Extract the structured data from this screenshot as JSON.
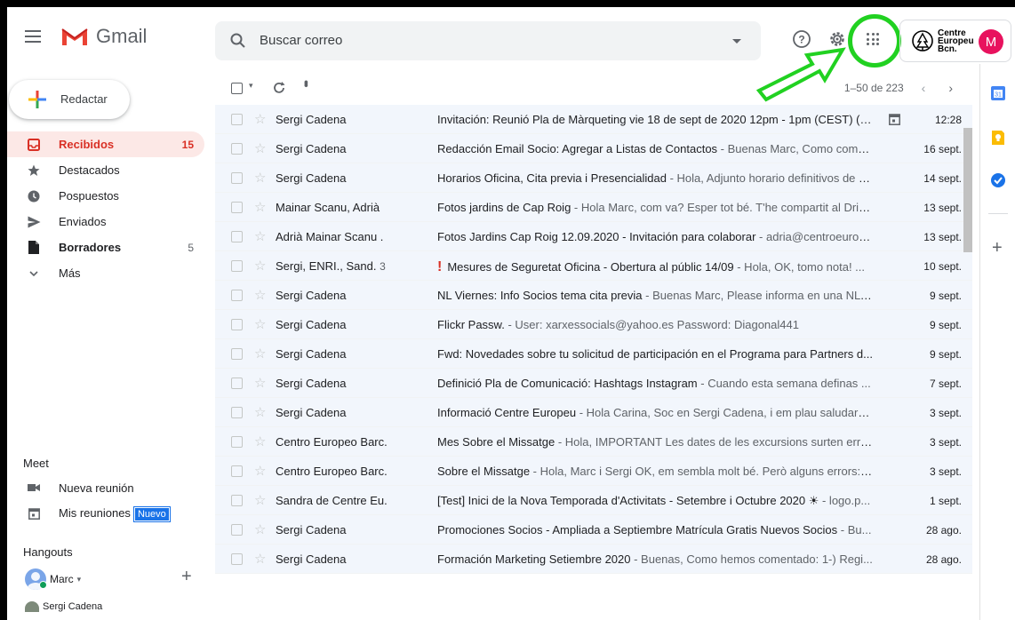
{
  "header": {
    "app_name": "Gmail",
    "search_placeholder": "Buscar correo",
    "brand_text_line1": "Centre",
    "brand_text_line2": "Europeu",
    "brand_text_line3": "Bcn.",
    "avatar_letter": "M"
  },
  "sidebar": {
    "compose_label": "Redactar",
    "items": [
      {
        "label": "Recibidos",
        "count": "15",
        "icon": "inbox-icon"
      },
      {
        "label": "Destacados",
        "count": "",
        "icon": "star-icon"
      },
      {
        "label": "Pospuestos",
        "count": "",
        "icon": "clock-icon"
      },
      {
        "label": "Enviados",
        "count": "",
        "icon": "send-icon"
      },
      {
        "label": "Borradores",
        "count": "5",
        "icon": "draft-icon"
      },
      {
        "label": "Más",
        "count": "",
        "icon": "chevron-down-icon"
      }
    ],
    "meet_title": "Meet",
    "meet_new": "Nueva reunión",
    "meet_mine": "Mis reuniones",
    "meet_badge": "Nuevo",
    "hangouts_title": "Hangouts",
    "hangouts_user": "Marc",
    "hangouts_contact": "Sergi Cadena"
  },
  "toolbar": {
    "pagination": "1–50 de 223"
  },
  "emails": [
    {
      "sender": "Sergi Cadena",
      "count": "",
      "important": false,
      "subject": "Invitación: Reunió Pla de Màrqueting vie 18 de sept de 2020 12pm - 1pm (CEST) (m...",
      "snippet": "",
      "date": "12:28",
      "calendar": true
    },
    {
      "sender": "Sergi Cadena",
      "count": "",
      "important": false,
      "subject": "Redacción Email Socio: Agregar a Listas de Contactos",
      "snippet": " - Buenas Marc, Como come...",
      "date": "16 sept.",
      "calendar": false
    },
    {
      "sender": "Sergi Cadena",
      "count": "",
      "important": false,
      "subject": "Horarios Oficina, Cita previa i Presencialidad",
      "snippet": " - Hola, Adjunto horario definitivos de c...",
      "date": "14 sept.",
      "calendar": false
    },
    {
      "sender": "Mainar Scanu, Adrià",
      "count": "",
      "important": false,
      "subject": "Fotos jardins de Cap Roig",
      "snippet": " - Hola Marc, com va? Esper tot bé. T'he compartit al Driv...",
      "date": "13 sept.",
      "calendar": false
    },
    {
      "sender": "Adrià Mainar Scanu .",
      "count": "",
      "important": false,
      "subject": "Fotos Jardins Cap Roig 12.09.2020 - Invitación para colaborar",
      "snippet": " - adria@centroeurop...",
      "date": "13 sept.",
      "calendar": false
    },
    {
      "sender": "Sergi, ENRI., Sand.",
      "count": "3",
      "important": true,
      "subject": "Mesures de Seguretat Oficina - Obertura al públic 14/09",
      "snippet": " - Hola, OK, tomo nota! ...",
      "date": "10 sept.",
      "calendar": false
    },
    {
      "sender": "Sergi Cadena",
      "count": "",
      "important": false,
      "subject": "NL Viernes: Info Socios tema cita previa",
      "snippet": " - Buenas Marc, Please informa en una NL ...",
      "date": "9 sept.",
      "calendar": false
    },
    {
      "sender": "Sergi Cadena",
      "count": "",
      "important": false,
      "subject": "Flickr Passw.",
      "snippet": " - User: xarxessocials@yahoo.es Password: Diagonal441",
      "date": "9 sept.",
      "calendar": false
    },
    {
      "sender": "Sergi Cadena",
      "count": "",
      "important": false,
      "subject": "Fwd: Novedades sobre tu solicitud de participación en el Programa para Partners d...",
      "snippet": "",
      "date": "9 sept.",
      "calendar": false
    },
    {
      "sender": "Sergi Cadena",
      "count": "",
      "important": false,
      "subject": "Definició Pla de Comunicació: Hashtags Instagram",
      "snippet": " - Cuando esta semana definas ...",
      "date": "7 sept.",
      "calendar": false
    },
    {
      "sender": "Sergi Cadena",
      "count": "",
      "important": false,
      "subject": "Informació Centre Europeu",
      "snippet": " - Hola Carina, Soc en Sergi Cadena, i em plau saludar-te...",
      "date": "3 sept.",
      "calendar": false
    },
    {
      "sender": "Centro Europeo Barc.",
      "count": "",
      "important": false,
      "subject": "Mes Sobre el Missatge",
      "snippet": " - Hola, IMPORTANT Les dates de les excursions surten errò...",
      "date": "3 sept.",
      "calendar": false
    },
    {
      "sender": "Centro Europeo Barc.",
      "count": "",
      "important": false,
      "subject": "Sobre el Missatge",
      "snippet": " - Hola, Marc i Sergi OK, em sembla molt bé. Però alguns errors: 1...",
      "date": "3 sept.",
      "calendar": false
    },
    {
      "sender": "Sandra de Centre Eu.",
      "count": "",
      "important": false,
      "subject": "[Test] Inici de la Nova Temporada d'Activitats - Setembre i Octubre 2020 ☀",
      "snippet": " - logo.p...",
      "date": "1 sept.",
      "calendar": false
    },
    {
      "sender": "Sergi Cadena",
      "count": "",
      "important": false,
      "subject": "Promociones Socios - Ampliada a Septiembre Matrícula Gratis Nuevos Socios",
      "snippet": " - Bu...",
      "date": "28 ago.",
      "calendar": false
    },
    {
      "sender": "Sergi Cadena",
      "count": "",
      "important": false,
      "subject": "Formación Marketing Setiembre 2020",
      "snippet": " - Buenas, Como hemos comentado: 1-) Regi...",
      "date": "28 ago.",
      "calendar": false
    }
  ],
  "colors": {
    "accent": "#d93025",
    "highlight": "#21d121",
    "avatar": "#e8125e"
  }
}
